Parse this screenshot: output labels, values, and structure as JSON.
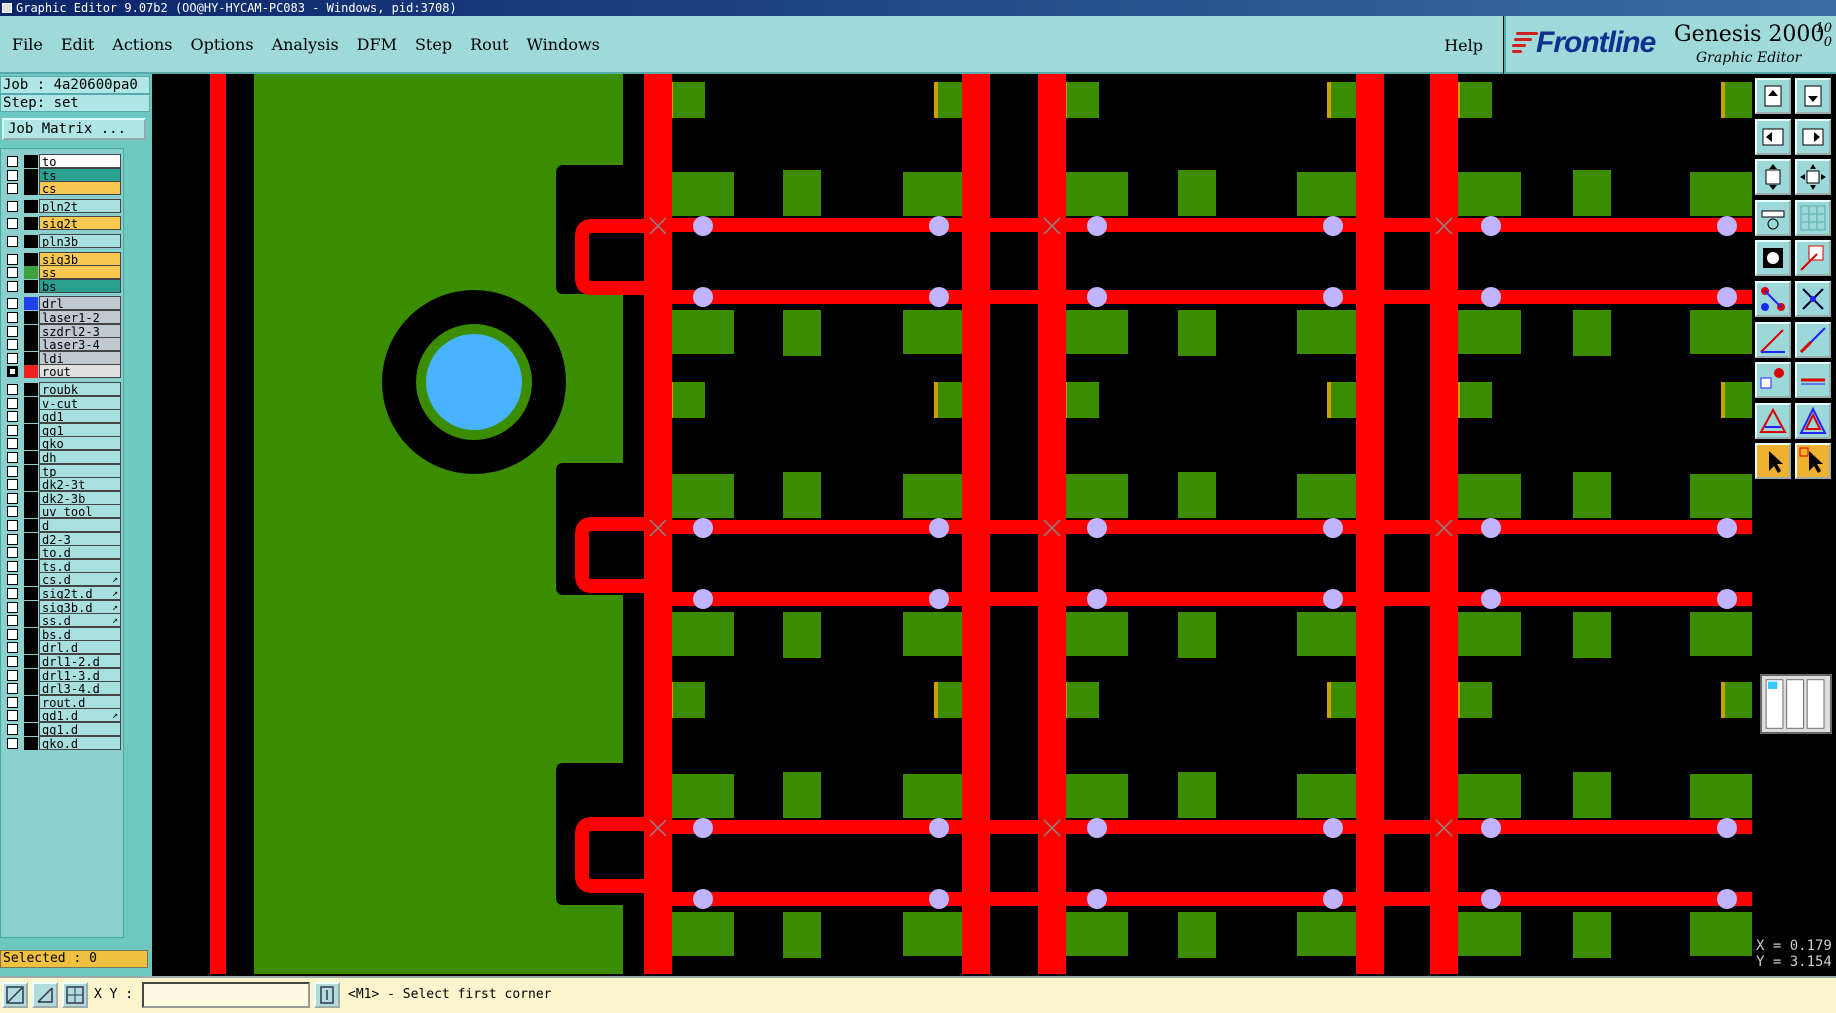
{
  "window": {
    "title": "Graphic Editor 9.07b2 (OO@HY-HYCAM-PC083 - Windows, pid:3708)"
  },
  "menu": {
    "items": [
      "File",
      "Edit",
      "Actions",
      "Options",
      "Analysis",
      "DFM",
      "Step",
      "Rout",
      "Windows"
    ],
    "help": "Help"
  },
  "brand": {
    "logo": "Frontline",
    "product": "Genesis 2000",
    "subtitle": "Graphic Editor",
    "version_top": "10",
    "version_bottom": "0"
  },
  "job": {
    "job_line": "Job : 4a20600pa0",
    "step_line": "Step: set",
    "matrix_button": "Job Matrix ..."
  },
  "layers": [
    {
      "name": "to",
      "color": "#ffffff",
      "swatch": "#000000"
    },
    {
      "name": "ts",
      "color": "#2aa090",
      "swatch": "#000000"
    },
    {
      "name": "cs",
      "color": "#f8c850",
      "swatch": "#000000"
    },
    {
      "name": "pln2t",
      "color": "#a8e0e0",
      "swatch": "#000000"
    },
    {
      "name": "sig2t",
      "color": "#f8c850",
      "swatch": "#000000"
    },
    {
      "name": "pln3b",
      "color": "#a8e0e0",
      "swatch": "#000000"
    },
    {
      "name": "sig3b",
      "color": "#f8c850",
      "swatch": "#000000"
    },
    {
      "name": "ss",
      "color": "#f8c850",
      "swatch": "#40a040"
    },
    {
      "name": "bs",
      "color": "#2aa090",
      "swatch": "#000000"
    },
    {
      "name": "drl",
      "color": "#c0c8d0",
      "swatch": "#2040f0"
    },
    {
      "name": "laser1-2",
      "color": "#c0c8d0",
      "swatch": "#000000"
    },
    {
      "name": "szdrl2-3",
      "color": "#c0c8d0",
      "swatch": "#000000"
    },
    {
      "name": "laser3-4",
      "color": "#c0c8d0",
      "swatch": "#000000"
    },
    {
      "name": "ldi",
      "color": "#c0c8d0",
      "swatch": "#000000"
    },
    {
      "name": "rout",
      "color": "#e0e0e0",
      "swatch": "#f02020",
      "active": true
    },
    {
      "name": "roubk",
      "color": "#a8e0e0",
      "swatch": "#000000"
    },
    {
      "name": "v-cut",
      "color": "#a8e0e0",
      "swatch": "#000000"
    },
    {
      "name": "gd1",
      "color": "#a8e0e0",
      "swatch": "#000000"
    },
    {
      "name": "gg1",
      "color": "#a8e0e0",
      "swatch": "#000000"
    },
    {
      "name": "gko",
      "color": "#a8e0e0",
      "swatch": "#000000"
    },
    {
      "name": "dh",
      "color": "#a8e0e0",
      "swatch": "#000000"
    },
    {
      "name": "tp",
      "color": "#a8e0e0",
      "swatch": "#000000"
    },
    {
      "name": "dk2-3t",
      "color": "#a8e0e0",
      "swatch": "#000000"
    },
    {
      "name": "dk2-3b",
      "color": "#a8e0e0",
      "swatch": "#000000"
    },
    {
      "name": "uv_tool",
      "color": "#a8e0e0",
      "swatch": "#000000"
    },
    {
      "name": "d",
      "color": "#a8e0e0",
      "swatch": "#000000"
    },
    {
      "name": "d2-3",
      "color": "#a8e0e0",
      "swatch": "#000000"
    },
    {
      "name": "to.d",
      "color": "#a8e0e0",
      "swatch": "#000000"
    },
    {
      "name": "ts.d",
      "color": "#a8e0e0",
      "swatch": "#000000"
    },
    {
      "name": "cs.d",
      "color": "#a8e0e0",
      "swatch": "#000000",
      "flag": true
    },
    {
      "name": "sig2t.d",
      "color": "#a8e0e0",
      "swatch": "#000000",
      "flag": true
    },
    {
      "name": "sig3b.d",
      "color": "#a8e0e0",
      "swatch": "#000000",
      "flag": true
    },
    {
      "name": "ss.d",
      "color": "#a8e0e0",
      "swatch": "#000000",
      "flag": true
    },
    {
      "name": "bs.d",
      "color": "#a8e0e0",
      "swatch": "#000000"
    },
    {
      "name": "drl.d",
      "color": "#a8e0e0",
      "swatch": "#000000"
    },
    {
      "name": "drl1-2.d",
      "color": "#a8e0e0",
      "swatch": "#000000"
    },
    {
      "name": "drl1-3.d",
      "color": "#a8e0e0",
      "swatch": "#000000"
    },
    {
      "name": "drl3-4.d",
      "color": "#a8e0e0",
      "swatch": "#000000"
    },
    {
      "name": "rout.d",
      "color": "#a8e0e0",
      "swatch": "#000000"
    },
    {
      "name": "gd1.d",
      "color": "#a8e0e0",
      "swatch": "#000000",
      "flag": true
    },
    {
      "name": "gg1.d",
      "color": "#a8e0e0",
      "swatch": "#000000"
    },
    {
      "name": "gko.d",
      "color": "#a8e0e0",
      "swatch": "#000000"
    }
  ],
  "selected": "Selected : 0",
  "coords": {
    "x": "X = 0.179",
    "y": "Y = 3.154"
  },
  "status": {
    "xy_label": "X Y :",
    "xy_value": "",
    "prompt": "<M1> - Select first corner"
  },
  "colors": {
    "copper": "#3c8c00",
    "pad": "#3c8c00",
    "pad_edge": "#c8a000",
    "route": "#ff0000",
    "drill": "#48b4ff",
    "via": "#c0b4ff",
    "panel_bg": "#9fd9d9"
  },
  "icons": {
    "right_tools": [
      "zoom-top-icon",
      "zoom-bottom-icon",
      "pan-left-icon",
      "pan-right-icon",
      "fit-vertical-icon",
      "fit-all-icon",
      "measure-icon",
      "grid-icon",
      "snap-icon",
      "mirror-icon",
      "route-nodes-icon",
      "cross-snap-icon",
      "line-red-icon",
      "line-blue-icon",
      "pad-select-icon",
      "minus-icon",
      "triangle-icon",
      "triangle-outline-icon",
      "pointer-icon",
      "pointer-alt-icon"
    ],
    "status_tools": [
      "draw-tool-icon",
      "angle-tool-icon",
      "grid-tool-icon"
    ]
  }
}
